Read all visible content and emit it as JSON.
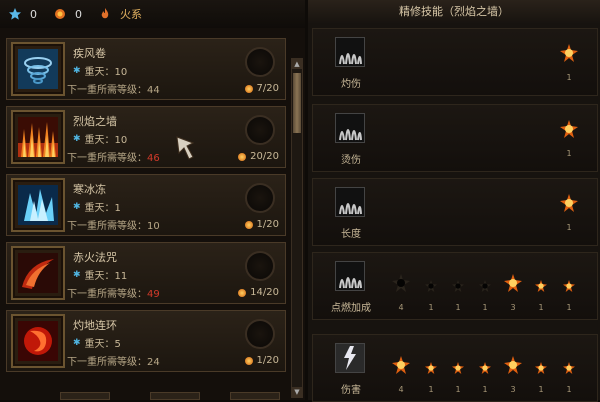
{
  "topbar": {
    "points_blue": "0",
    "points_orange": "0",
    "element": "火系"
  },
  "skills": [
    {
      "name": "疾风卷",
      "level_label": "重天：10",
      "req_label": "下一重所需等级：",
      "req_value": "44",
      "req_red": false,
      "progress": "7/20"
    },
    {
      "name": "烈焰之墙",
      "level_label": "重天：10",
      "req_label": "下一重所需等级：",
      "req_value": "46",
      "req_red": true,
      "progress": "20/20"
    },
    {
      "name": "寒冰冻",
      "level_label": "重天：1",
      "req_label": "下一重所需等级：",
      "req_value": "10",
      "req_red": false,
      "progress": "1/20"
    },
    {
      "name": "赤火法咒",
      "level_label": "重天：11",
      "req_label": "下一重所需等级：",
      "req_value": "49",
      "req_red": true,
      "progress": "14/20"
    },
    {
      "name": "灼地连环",
      "level_label": "重天：5",
      "req_label": "下一重所需等级：",
      "req_value": "24",
      "req_red": false,
      "progress": "1/20"
    }
  ],
  "refine": {
    "title": "精修技能（烈焰之墙）",
    "rows": [
      {
        "label": "灼伤",
        "counts": [
          "1"
        ]
      },
      {
        "label": "烫伤",
        "counts": [
          "1"
        ]
      },
      {
        "label": "长度",
        "counts": [
          "1"
        ]
      },
      {
        "label": "点燃加成",
        "counts": [
          "4",
          "1",
          "1",
          "1",
          "3",
          "1",
          "1"
        ]
      },
      {
        "label": "伤害",
        "counts": [
          "4",
          "1",
          "1",
          "1",
          "3",
          "1",
          "1"
        ]
      }
    ]
  },
  "colors": {
    "accent": "#e0a030",
    "red": "#d23a2a",
    "blue": "#4fb4e0"
  }
}
